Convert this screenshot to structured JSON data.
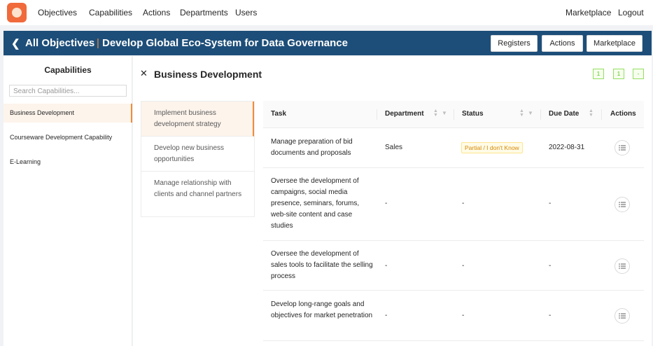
{
  "nav": {
    "items": [
      "Objectives",
      "Capabilities",
      "Actions",
      "Departments",
      "Users"
    ],
    "right": [
      "Marketplace",
      "Logout"
    ]
  },
  "header": {
    "back_label": "All Objectives",
    "separator": "|",
    "title": "Develop Global Eco-System for Data Governance",
    "buttons": [
      "Registers",
      "Actions",
      "Marketplace"
    ]
  },
  "sidebar": {
    "title": "Capabilities",
    "search_placeholder": "Search Capabilities...",
    "items": [
      "Business Development",
      "Courseware Development Capability",
      "E-Learning"
    ]
  },
  "main": {
    "close_icon": "close-icon",
    "title": "Business Development",
    "badges": [
      "1",
      "1",
      "-"
    ],
    "strategies": [
      "Implement business development strategy",
      "Develop new business opportunities",
      "Manage relationship with clients and channel partners"
    ],
    "table": {
      "headers": [
        "Task",
        "Department",
        "Status",
        "Due Date",
        "Actions"
      ],
      "rows": [
        {
          "task": "Manage preparation of bid documents and proposals",
          "department": "Sales",
          "status": "Partial / I don't Know",
          "due": "2022-08-31"
        },
        {
          "task": "Oversee the development of campaigns, social media presence, seminars, forums, web-site content and case studies",
          "department": "-",
          "status": "-",
          "due": "-"
        },
        {
          "task": "Oversee the development of sales tools to facilitate the selling process",
          "department": "-",
          "status": "-",
          "due": "-"
        },
        {
          "task": "Develop long-range goals and objectives for market penetration",
          "department": "-",
          "status": "-",
          "due": "-"
        }
      ]
    }
  },
  "colors": {
    "accent": "#f08c3a",
    "header": "#1d4e79",
    "status": "#d48806"
  }
}
